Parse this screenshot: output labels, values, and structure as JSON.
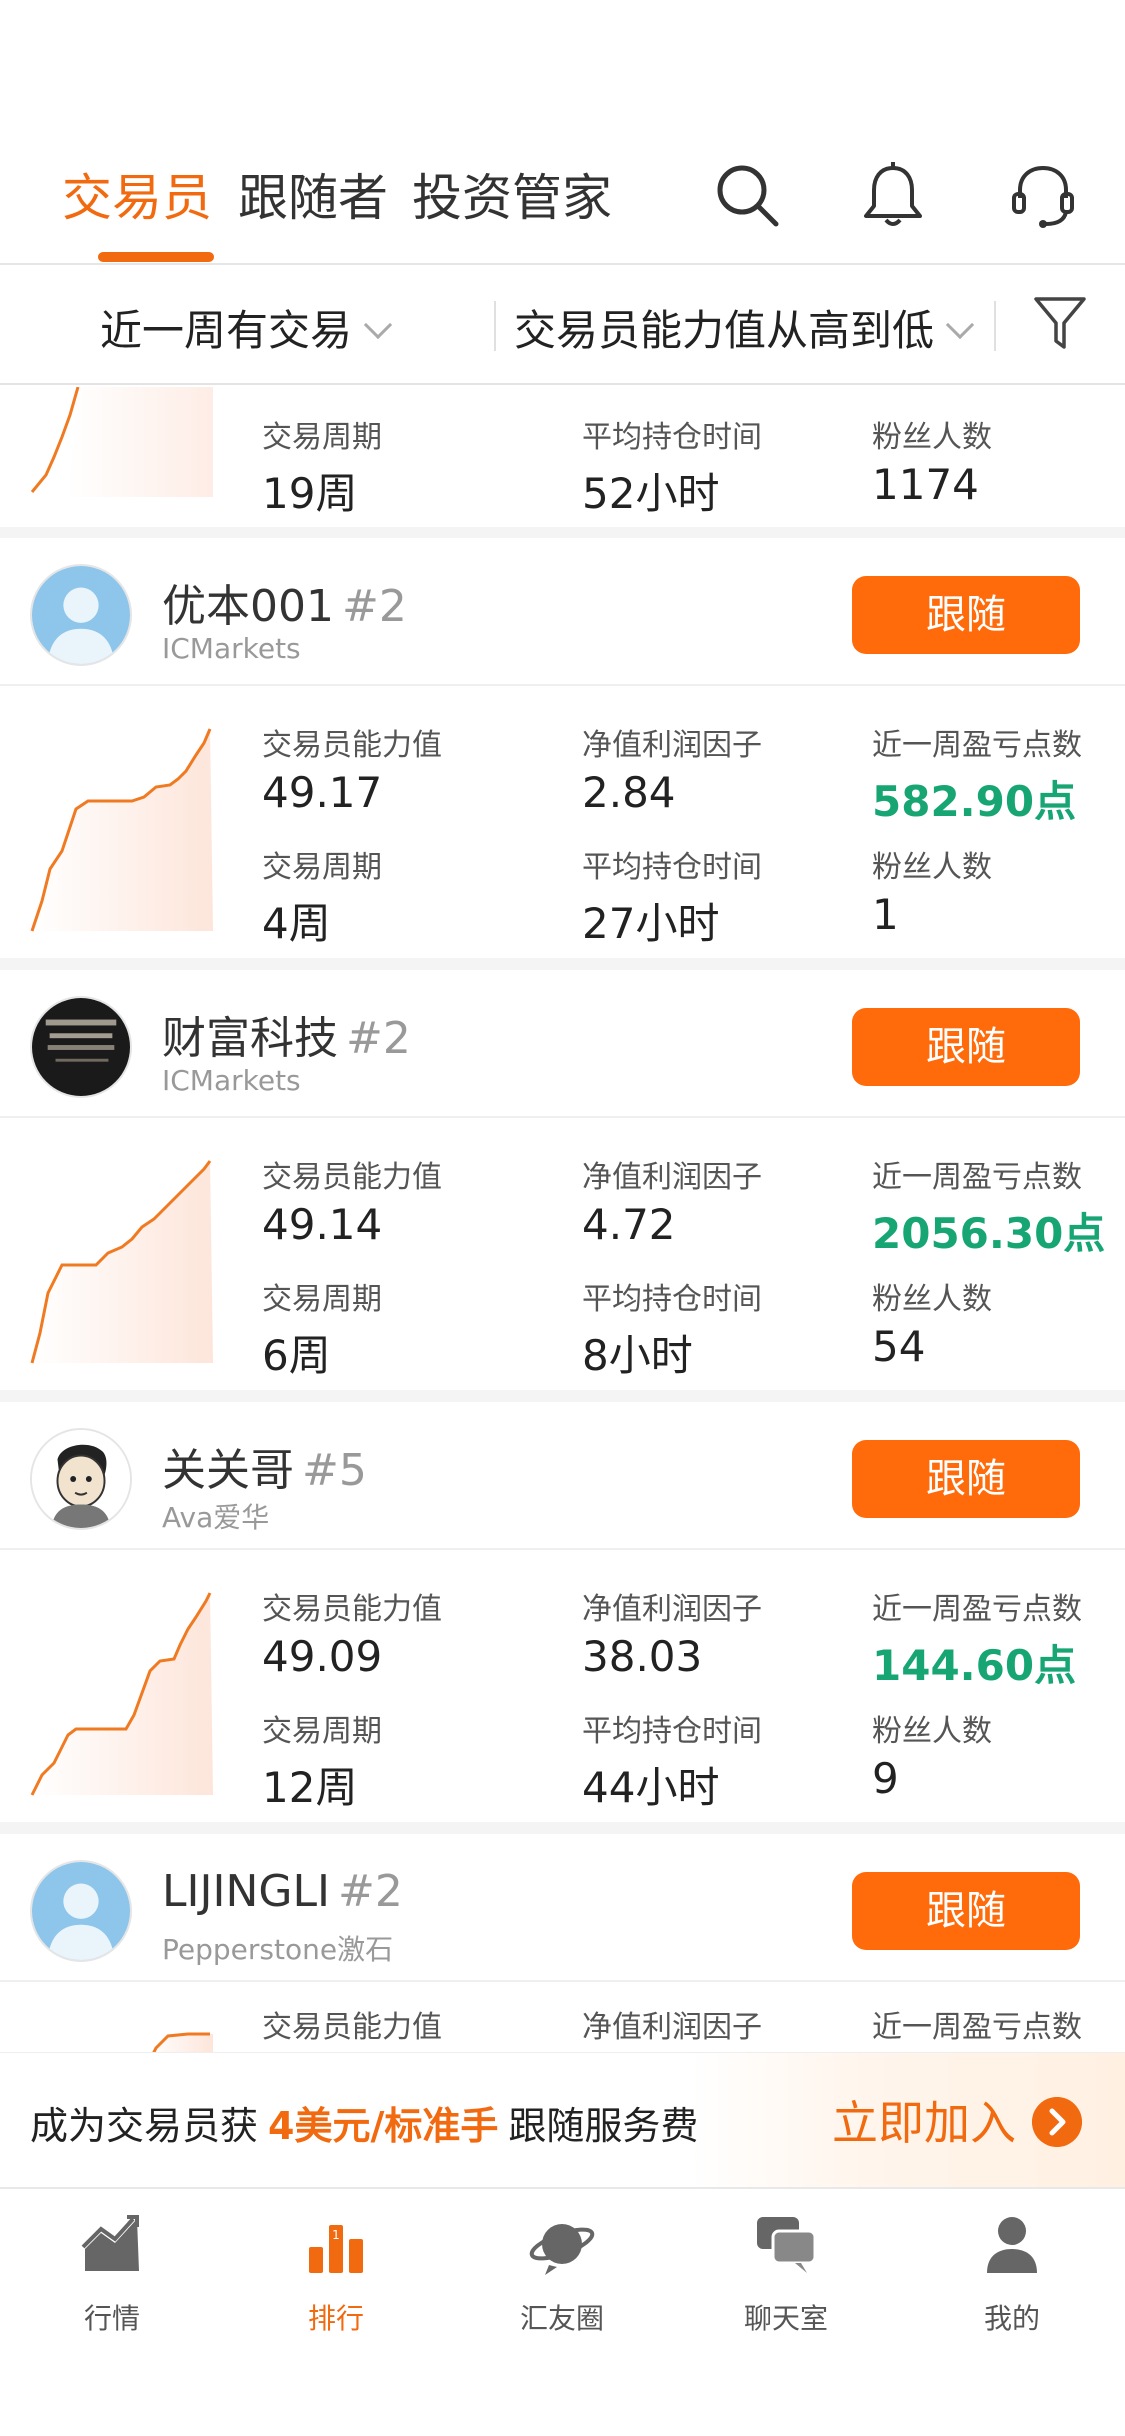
{
  "tabs": [
    {
      "label": "交易员",
      "active": true
    },
    {
      "label": "跟随者",
      "active": false
    },
    {
      "label": "投资管家",
      "active": false
    }
  ],
  "icons": {
    "search": "search-icon",
    "bell": "bell-icon",
    "support": "headset-icon",
    "filter": "funnel-icon"
  },
  "filters": {
    "period": "近一周有交易",
    "sort": "交易员能力值从高到低"
  },
  "partial_card": {
    "stats": [
      {
        "label": "交易周期",
        "value": "19周"
      },
      {
        "label": "平均持仓时间",
        "value": "52小时"
      },
      {
        "label": "粉丝人数",
        "value": "1174"
      }
    ]
  },
  "cards": [
    {
      "name": "优本001",
      "rank": "#2",
      "broker": "ICMarkets",
      "follow_label": "跟随",
      "stats": [
        {
          "label": "交易员能力值",
          "value": "49.17"
        },
        {
          "label": "净值利润因子",
          "value": "2.84"
        },
        {
          "label": "近一周盈亏点数",
          "value": "582.90点",
          "green": true
        },
        {
          "label": "交易周期",
          "value": "4周"
        },
        {
          "label": "平均持仓时间",
          "value": "27小时"
        },
        {
          "label": "粉丝人数",
          "value": "1"
        }
      ]
    },
    {
      "name": "财富科技",
      "rank": "#2",
      "broker": "ICMarkets",
      "follow_label": "跟随",
      "stats": [
        {
          "label": "交易员能力值",
          "value": "49.14"
        },
        {
          "label": "净值利润因子",
          "value": "4.72"
        },
        {
          "label": "近一周盈亏点数",
          "value": "2056.30点",
          "green": true
        },
        {
          "label": "交易周期",
          "value": "6周"
        },
        {
          "label": "平均持仓时间",
          "value": "8小时"
        },
        {
          "label": "粉丝人数",
          "value": "54"
        }
      ]
    },
    {
      "name": "关关哥",
      "rank": "#5",
      "broker": "Ava爱华",
      "follow_label": "跟随",
      "stats": [
        {
          "label": "交易员能力值",
          "value": "49.09"
        },
        {
          "label": "净值利润因子",
          "value": "38.03"
        },
        {
          "label": "近一周盈亏点数",
          "value": "144.60点",
          "green": true
        },
        {
          "label": "交易周期",
          "value": "12周"
        },
        {
          "label": "平均持仓时间",
          "value": "44小时"
        },
        {
          "label": "粉丝人数",
          "value": "9"
        }
      ]
    },
    {
      "name": "LIJINGLI",
      "rank": "#2",
      "broker": "Pepperstone激石",
      "follow_label": "跟随",
      "stats": [
        {
          "label": "交易员能力值",
          "value": ""
        },
        {
          "label": "净值利润因子",
          "value": ""
        },
        {
          "label": "近一周盈亏点数",
          "value": ""
        }
      ]
    }
  ],
  "banner": {
    "prefix": "成为交易员获",
    "highlight": "4美元/标准手",
    "suffix": "跟随服务费",
    "cta": "立即加入"
  },
  "bottom_nav": [
    {
      "label": "行情",
      "icon": "market-chart-icon",
      "active": false
    },
    {
      "label": "排行",
      "icon": "ranking-icon",
      "active": true
    },
    {
      "label": "汇友圈",
      "icon": "planet-icon",
      "active": false
    },
    {
      "label": "聊天室",
      "icon": "chat-icon",
      "active": false
    },
    {
      "label": "我的",
      "icon": "user-icon",
      "active": false
    }
  ],
  "colors": {
    "accent": "#f26a10",
    "button": "#ff6a0a",
    "green": "#17a673"
  }
}
